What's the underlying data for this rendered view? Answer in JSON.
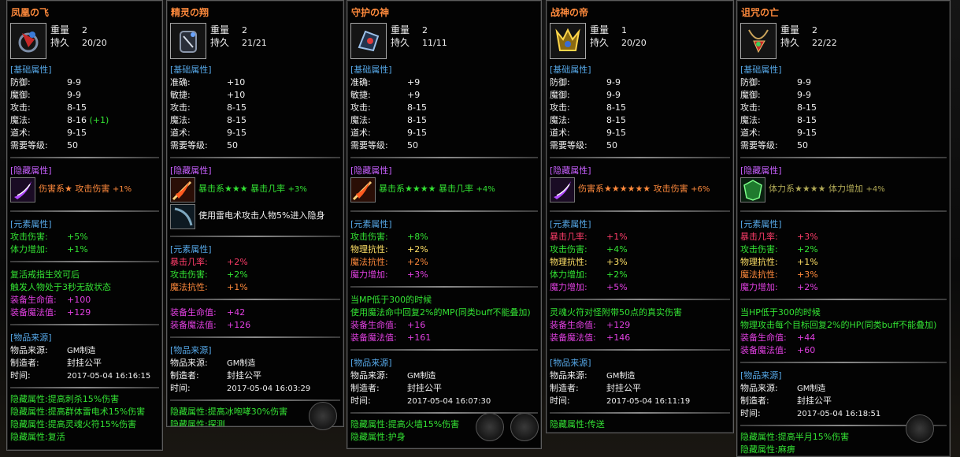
{
  "panels": [
    {
      "title": "凤凰の飞",
      "icon": "ring-icon",
      "weight_label": "重量",
      "weight": "2",
      "dur_label": "持久",
      "dur": "20/20",
      "base_header": "[基础属性]",
      "base": [
        {
          "k": "防御:",
          "v": "9-9"
        },
        {
          "k": "魔御:",
          "v": "9-9"
        },
        {
          "k": "攻击:",
          "v": "8-15"
        },
        {
          "k": "魔法:",
          "v": "8-16",
          "extra": "(+1)"
        },
        {
          "k": "道术:",
          "v": "9-15"
        },
        {
          "k": "需要等级:",
          "v": "50"
        }
      ],
      "hidden_header": "[隐藏属性]",
      "hidden1": {
        "icon": "purple-slash-skill-icon",
        "a": "伤害系",
        "stars": "★",
        "b": "攻击伤害",
        "c": "+1%"
      },
      "elem_header": "[元素属性]",
      "elem": [
        {
          "k": "攻击伤害:",
          "v": "+5%"
        },
        {
          "k": "体力增加:",
          "v": "+1%"
        }
      ],
      "special": [
        "复活戒指生效可后",
        "触发人物处于3秒无敌状态"
      ],
      "bonus": [
        {
          "k": "装备生命值:",
          "v": "+100"
        },
        {
          "k": "装备魔法值:",
          "v": "+129"
        }
      ],
      "source_header": "[物品来源]",
      "source": [
        {
          "k": "物品来源:",
          "v": "GM制造"
        },
        {
          "k": "制造者:",
          "v": "封挂公平"
        },
        {
          "k": "时间:",
          "v": "2017-05-04 16:16:15"
        }
      ],
      "footer": [
        "隐藏属性:提高刺杀15%伤害",
        "隐藏属性:提高群体雷电术15%伤害",
        "隐藏属性:提高灵魂火符15%伤害",
        "隐藏属性:复活"
      ]
    },
    {
      "title": "精灵の翔",
      "icon": "bracelet-icon",
      "weight_label": "重量",
      "weight": "2",
      "dur_label": "持久",
      "dur": "21/21",
      "base_header": "[基础属性]",
      "base": [
        {
          "k": "准确:",
          "v": "+10"
        },
        {
          "k": "敏捷:",
          "v": "+10"
        },
        {
          "k": "攻击:",
          "v": "8-15"
        },
        {
          "k": "魔法:",
          "v": "8-15"
        },
        {
          "k": "道术:",
          "v": "9-15"
        },
        {
          "k": "需要等级:",
          "v": "50"
        }
      ],
      "hidden_header": "[隐藏属性]",
      "hidden1": {
        "icon": "fire-sword-skill-icon",
        "a": "暴击系",
        "stars": "★★★",
        "b": "暴击几率",
        "c": "+3%"
      },
      "hidden2": {
        "icon": "dark-blade-skill-icon",
        "text": "使用雷电术攻击人物5%进入隐身"
      },
      "elem_header": "[元素属性]",
      "elem": [
        {
          "k": "暴击几率:",
          "v": "+2%"
        },
        {
          "k": "攻击伤害:",
          "v": "+2%"
        },
        {
          "k": "魔法抗性:",
          "v": "+1%"
        }
      ],
      "bonus": [
        {
          "k": "装备生命值:",
          "v": "+42"
        },
        {
          "k": "装备魔法值:",
          "v": "+126"
        }
      ],
      "source_header": "[物品来源]",
      "source": [
        {
          "k": "物品来源:",
          "v": "GM制造"
        },
        {
          "k": "制造者:",
          "v": "封挂公平"
        },
        {
          "k": "时间:",
          "v": "2017-05-04 16:03:29"
        }
      ],
      "footer": [
        "隐藏属性:提高冰咆哮30%伤害",
        "隐藏属性:探测"
      ]
    },
    {
      "title": "守护の神",
      "icon": "gauntlet-icon",
      "weight_label": "重量",
      "weight": "2",
      "dur_label": "持久",
      "dur": "11/11",
      "base_header": "[基础属性]",
      "base": [
        {
          "k": "准确:",
          "v": "+9"
        },
        {
          "k": "敏捷:",
          "v": "+9"
        },
        {
          "k": "攻击:",
          "v": "8-15"
        },
        {
          "k": "魔法:",
          "v": "8-15"
        },
        {
          "k": "道术:",
          "v": "9-15"
        },
        {
          "k": "需要等级:",
          "v": "50"
        }
      ],
      "hidden_header": "[隐藏属性]",
      "hidden1": {
        "icon": "fire-sword-skill-icon",
        "a": "暴击系",
        "stars": "★★★★",
        "b": "暴击几率",
        "c": "+4%"
      },
      "elem_header": "[元素属性]",
      "elem": [
        {
          "k": "攻击伤害:",
          "v": "+8%",
          "c": "grn"
        },
        {
          "k": "物理抗性:",
          "v": "+2%",
          "c": "ylw"
        },
        {
          "k": "魔法抗性:",
          "v": "+2%",
          "c": "orange"
        },
        {
          "k": "魔力增加:",
          "v": "+3%",
          "c": "mag"
        }
      ],
      "special": [
        "当MP低于300的时候",
        "使用魔法命中回复2%的MP(同类buff不能叠加)"
      ],
      "bonus": [
        {
          "k": "装备生命值:",
          "v": "+16"
        },
        {
          "k": "装备魔法值:",
          "v": "+161"
        }
      ],
      "source_header": "[物品来源]",
      "source": [
        {
          "k": "物品来源:",
          "v": "GM制造"
        },
        {
          "k": "制造者:",
          "v": "封挂公平"
        },
        {
          "k": "时间:",
          "v": "2017-05-04 16:07:30"
        }
      ],
      "footer": [
        "隐藏属性:提高火墙15%伤害",
        "隐藏属性:护身"
      ]
    },
    {
      "title": "战神の帝",
      "icon": "helmet-icon",
      "weight_label": "重量",
      "weight": "1",
      "dur_label": "持久",
      "dur": "20/20",
      "base_header": "[基础属性]",
      "base": [
        {
          "k": "防御:",
          "v": "9-9"
        },
        {
          "k": "魔御:",
          "v": "9-9"
        },
        {
          "k": "攻击:",
          "v": "8-15"
        },
        {
          "k": "魔法:",
          "v": "8-15"
        },
        {
          "k": "道术:",
          "v": "9-15"
        },
        {
          "k": "需要等级:",
          "v": "50"
        }
      ],
      "hidden_header": "[隐藏属性]",
      "hidden1": {
        "icon": "purple-slash-skill-icon",
        "a": "伤害系",
        "stars": "★★★★★★",
        "b": "攻击伤害",
        "c": "+6%"
      },
      "elem_header": "[元素属性]",
      "elem": [
        {
          "k": "暴击几率:",
          "v": "+1%",
          "c": "red"
        },
        {
          "k": "攻击伤害:",
          "v": "+4%",
          "c": "grn"
        },
        {
          "k": "物理抗性:",
          "v": "+3%",
          "c": "ylw"
        },
        {
          "k": "体力增加:",
          "v": "+2%",
          "c": "grn"
        },
        {
          "k": "魔力增加:",
          "v": "+5%",
          "c": "mag"
        }
      ],
      "special": [
        "灵魂火符对怪附带50点的真实伤害"
      ],
      "bonus": [
        {
          "k": "装备生命值:",
          "v": "+129"
        },
        {
          "k": "装备魔法值:",
          "v": "+146"
        }
      ],
      "source_header": "[物品来源]",
      "source": [
        {
          "k": "物品来源:",
          "v": "GM制造"
        },
        {
          "k": "制造者:",
          "v": "封挂公平"
        },
        {
          "k": "时间:",
          "v": "2017-05-04 16:11:19"
        }
      ],
      "footer": [
        "隐藏属性:传送"
      ]
    },
    {
      "title": "诅咒の亡",
      "icon": "necklace-icon",
      "weight_label": "重量",
      "weight": "2",
      "dur_label": "持久",
      "dur": "22/22",
      "base_header": "[基础属性]",
      "base": [
        {
          "k": "防御:",
          "v": "9-9"
        },
        {
          "k": "魔御:",
          "v": "9-9"
        },
        {
          "k": "攻击:",
          "v": "8-15"
        },
        {
          "k": "魔法:",
          "v": "8-15"
        },
        {
          "k": "道术:",
          "v": "9-15"
        },
        {
          "k": "需要等级:",
          "v": "50"
        }
      ],
      "hidden_header": "[隐藏属性]",
      "hidden1": {
        "icon": "green-shield-skill-icon",
        "a": "体力系",
        "stars": "★★★★",
        "b": "体力增加",
        "c": "+4%"
      },
      "elem_header": "[元素属性]",
      "elem": [
        {
          "k": "暴击几率:",
          "v": "+3%",
          "c": "red"
        },
        {
          "k": "攻击伤害:",
          "v": "+2%",
          "c": "grn"
        },
        {
          "k": "物理抗性:",
          "v": "+1%",
          "c": "ylw"
        },
        {
          "k": "魔法抗性:",
          "v": "+3%",
          "c": "orange"
        },
        {
          "k": "魔力增加:",
          "v": "+2%",
          "c": "mag"
        }
      ],
      "special": [
        "当HP低于300的时候",
        "物理攻击每个目标回复2%的HP(同类buff不能叠加)"
      ],
      "bonus": [
        {
          "k": "装备生命值:",
          "v": "+44"
        },
        {
          "k": "装备魔法值:",
          "v": "+60"
        }
      ],
      "source_header": "[物品来源]",
      "source": [
        {
          "k": "物品来源:",
          "v": "GM制造"
        },
        {
          "k": "制造者:",
          "v": "封挂公平"
        },
        {
          "k": "时间:",
          "v": "2017-05-04 16:18:51"
        }
      ],
      "footer": [
        "隐藏属性:提高半月15%伤害",
        "隐藏属性:麻痹"
      ]
    }
  ]
}
